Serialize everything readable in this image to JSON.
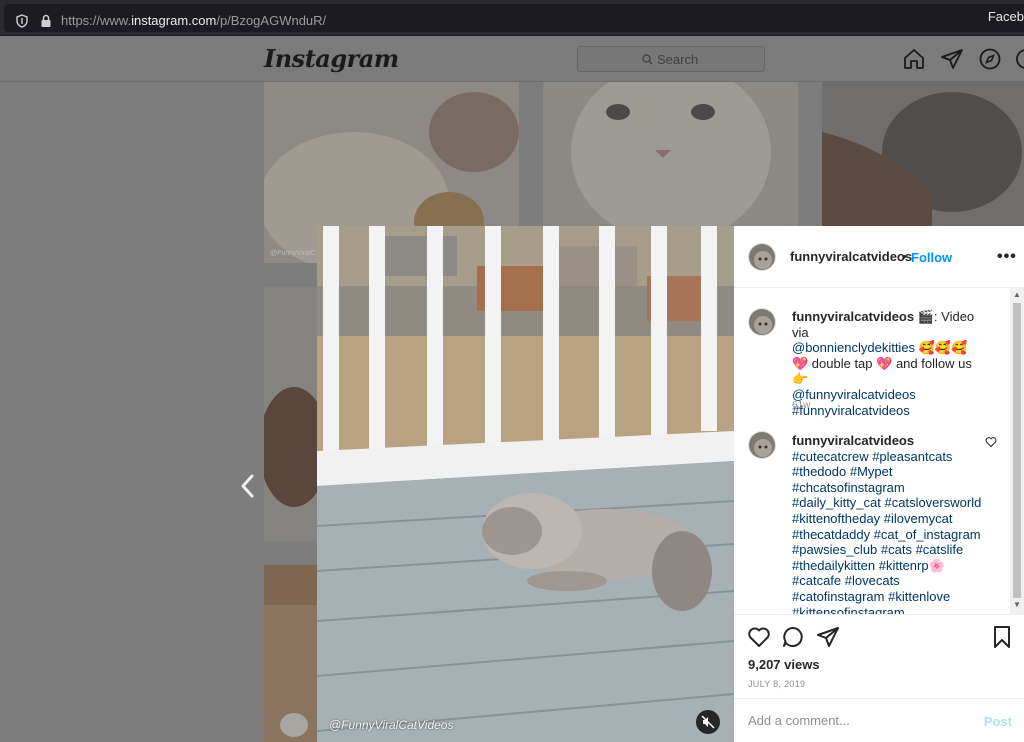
{
  "browser": {
    "url_prefix": "https://www.",
    "url_host": "instagram.com",
    "url_path": "/p/BzogAGWnduR/",
    "right_text": "Faceb"
  },
  "header": {
    "logo": "Instagram",
    "search_placeholder": "Search",
    "icons": [
      "home-icon",
      "direct-icon",
      "explore-icon",
      "activity-icon"
    ]
  },
  "grid_watermark": "@FunnyViralC",
  "post": {
    "username": "funnyviralcatvideos",
    "follow_label": "Follow",
    "dot": "•",
    "more": "•••",
    "watermark": "@FunnyViralCatVideos",
    "caption": {
      "username": "funnyviralcatvideos",
      "emoji_clapper": "🎬",
      "line1_text": ": Video via",
      "mention1": "@bonnienclydekitties",
      "emoji_faces": "🥰🥰🥰",
      "emoji_heart1": "💖",
      "text2": " double tap ",
      "emoji_heart2": "💖",
      "text3": " and follow us ",
      "emoji_point": "👉",
      "mention2": "@funnyviralcatvideos",
      "hashtag": "#funnyviralcatvideos",
      "time": "61w"
    },
    "comment": {
      "username": "funnyviralcatvideos",
      "hashtags_line1": "#cutecatcrew #pleasantcats",
      "hashtags_line2": "#thedodo #Mypet",
      "hashtags_line3": "#chcatsofinstagram",
      "hashtags_line4": "#daily_kitty_cat #catsloversworld",
      "hashtags_line5": "#kittenoftheday #ilovemycat",
      "hashtags_line6": "#thecatdaddy #cat_of_instagram",
      "hashtags_line7": "#pawsies_club #cats #catslife",
      "hashtags_line8": "#thedailykitten #kittenrp",
      "emoji_flower": "🌸",
      "hashtags_line9": "#catcafe #lovecats",
      "hashtags_line10": "#catofinstagram #kittenlove",
      "hashtags_line11": "#kittensofinstagram"
    },
    "views": "9,207 views",
    "date": "JULY 8, 2019",
    "comment_placeholder": "Add a comment...",
    "post_label": "Post"
  }
}
